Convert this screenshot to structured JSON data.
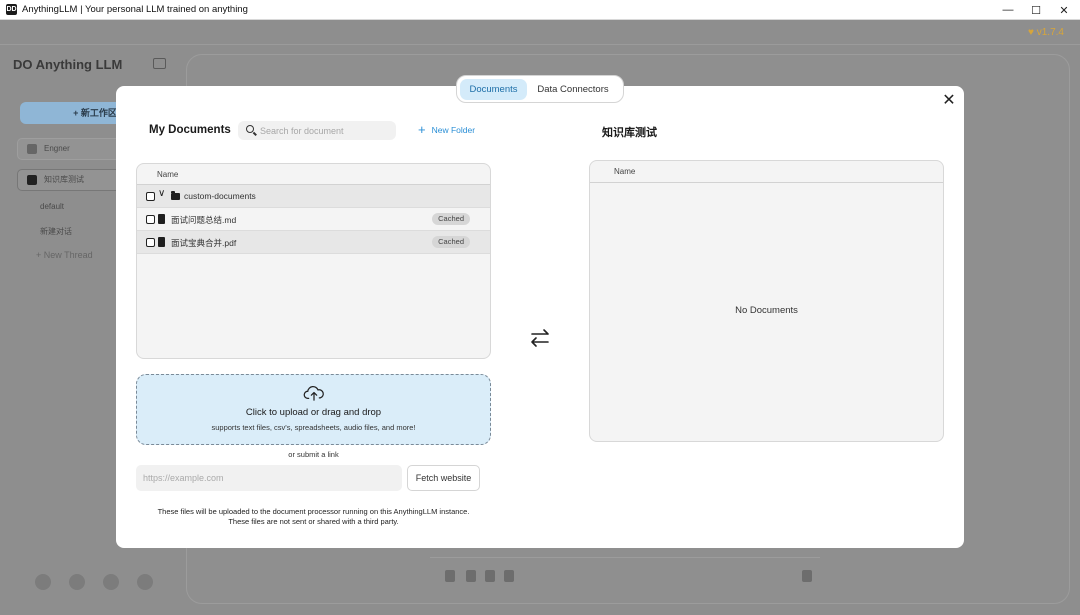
{
  "window": {
    "title": "AnythingLLM | Your personal LLM trained on anything",
    "app_icon_text": "DD",
    "minimize": "—",
    "maximize": "☐",
    "close": "✕"
  },
  "background": {
    "version": "♥ v1.7.4",
    "brand": "DO Anything LLM",
    "new_workspace": "+ 新工作区",
    "sidebar_items": [
      {
        "label": "Engner"
      },
      {
        "label": "知识库测试"
      }
    ],
    "threads": [
      "default",
      "新建对话"
    ],
    "new_thread": "+   New Thread"
  },
  "modal": {
    "tabs": [
      {
        "label": "Documents"
      },
      {
        "label": "Data Connectors"
      }
    ],
    "close_label": "✕",
    "my_documents": {
      "title": "My Documents",
      "search_placeholder": "Search for document",
      "new_folder_plus": "+",
      "new_folder_label": "New Folder",
      "column_name": "Name",
      "folder": {
        "name": "custom-documents",
        "chevron": "∨"
      },
      "files": [
        {
          "name": "面试问题总结.md",
          "status": "Cached"
        },
        {
          "name": "面试宝典合并.pdf",
          "status": "Cached"
        }
      ]
    },
    "upload": {
      "title": "Click to upload or drag and drop",
      "subtitle": "supports text files, csv's, spreadsheets, audio files, and more!"
    },
    "or_submit_link": "or submit a link",
    "url_placeholder": "https://example.com",
    "fetch_label": "Fetch website",
    "note_line1": "These files will be uploaded to the document processor running on this AnythingLLM instance.",
    "note_line2": "These files are not sent or shared with a third party.",
    "workspace": {
      "title": "知识库测试",
      "column_name": "Name",
      "empty": "No Documents"
    }
  }
}
